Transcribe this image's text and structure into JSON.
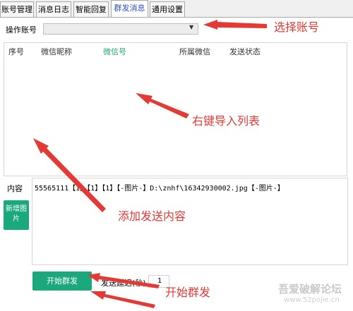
{
  "tabs": [
    {
      "label": "账号管理",
      "active": false
    },
    {
      "label": "消息日志",
      "active": false
    },
    {
      "label": "智能回复",
      "active": false
    },
    {
      "label": "群发消息",
      "active": true
    },
    {
      "label": "通用设置",
      "active": false
    }
  ],
  "account": {
    "label": "操作账号",
    "value": ""
  },
  "list": {
    "columns": [
      "序号",
      "微信昵称",
      "微信号",
      "所属微信",
      "发送状态"
    ],
    "rows": []
  },
  "content": {
    "label": "内容",
    "text": "55565111【1】【1】【1】【-图片-】D:\\znhf\\16342930002.jpg【-图片-】",
    "add_image_label": "新增图片"
  },
  "send": {
    "start_label": "开始群发",
    "delay_label": "发送延迟(秒)",
    "delay_value": "1"
  },
  "annotations": {
    "select_account": "选择账号",
    "import_list": "右键导入列表",
    "add_content": "添加发送内容",
    "start_send": "开始群发"
  },
  "watermark": {
    "line1": "吾爱破解论坛",
    "line2": "www.52pojie.cn"
  },
  "colors": {
    "accent_green": "#1aa87c",
    "annotation_red": "#e53935",
    "active_tab": "#3050c8"
  }
}
